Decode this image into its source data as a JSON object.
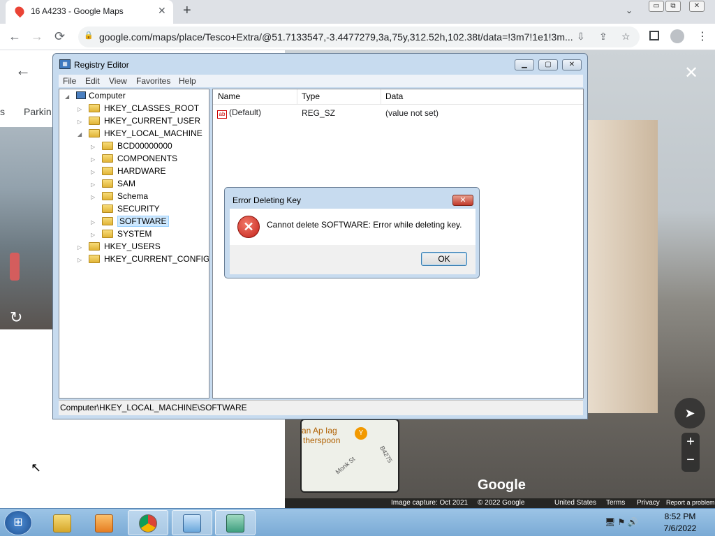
{
  "browser": {
    "tab_title": "16 A4233 - Google Maps",
    "tab_close": "✕",
    "new_tab": "+",
    "url": "google.com/maps/place/Tesco+Extra/@51.7133547,-3.4477279,3a,75y,312.52h,102.38t/data=!3m7!1e1!3m...",
    "back_icon": "←",
    "forward_icon": "→",
    "reload_icon": "⟳",
    "lock_icon": "🔒"
  },
  "maps": {
    "back_icon": "←",
    "parking_label": "Parkin",
    "parking_prefix": "s",
    "close_icon": "✕",
    "zoom_in": "+",
    "zoom_out": "−",
    "logo": "Google",
    "minimap": {
      "label_line1": "an Ap Iag",
      "label_line2": "therspoon",
      "street1": "Monk St",
      "street2": "B4275"
    },
    "footer": [
      "Image capture: Oct 2021",
      "© 2022 Google",
      "United States",
      "Terms",
      "Privacy",
      "Report a problem"
    ]
  },
  "regedit": {
    "title": "Registry Editor",
    "menu": [
      "File",
      "Edit",
      "View",
      "Favorites",
      "Help"
    ],
    "tree": {
      "root": "Computer",
      "hives": [
        "HKEY_CLASSES_ROOT",
        "HKEY_CURRENT_USER",
        "HKEY_LOCAL_MACHINE"
      ],
      "hklm_children": [
        "BCD00000000",
        "COMPONENTS",
        "HARDWARE",
        "SAM",
        "Schema",
        "SECURITY",
        "SOFTWARE",
        "SYSTEM"
      ],
      "more_hives": [
        "HKEY_USERS",
        "HKEY_CURRENT_CONFIG"
      ],
      "selected": "SOFTWARE"
    },
    "columns": [
      "Name",
      "Type",
      "Data"
    ],
    "values": [
      {
        "name": "(Default)",
        "type": "REG_SZ",
        "data": "(value not set)"
      }
    ],
    "status": "Computer\\HKEY_LOCAL_MACHINE\\SOFTWARE"
  },
  "dialog": {
    "title": "Error Deleting Key",
    "message": "Cannot delete SOFTWARE:  Error while deleting key.",
    "ok_label": "OK",
    "icon_glyph": "✕"
  },
  "taskbar": {
    "time": "8:52 PM",
    "date": "7/6/2022",
    "tray": "🖥 ⚑ 🔊"
  },
  "colors": {
    "window_frame": "#c7dbef",
    "error_red": "#c4221a",
    "taskbar": "#7aaad5"
  }
}
